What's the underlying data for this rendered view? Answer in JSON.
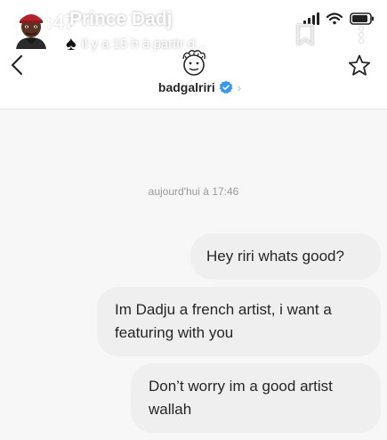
{
  "status_bar": {
    "time": ":47"
  },
  "story_overlay": {
    "name": "Prince Dadj",
    "subtitle": "il y a 15 h à partir d..."
  },
  "header": {
    "username": "badgalriri"
  },
  "conversation": {
    "timestamp": "aujourd'hui à 17:46",
    "messages": [
      {
        "text": "Hey riri whats good?"
      },
      {
        "text": "Im Dadju a french artist, i want a featuring with you"
      },
      {
        "text": "Don’t worry im a good artist wallah"
      }
    ]
  },
  "colors": {
    "bubble": "#efefef",
    "verified": "#3897f0",
    "background": "#f7f7f7"
  },
  "icons": [
    "spade-icon",
    "bookmark-icon",
    "more-icon",
    "back-icon",
    "verified-icon",
    "chevron-right-icon",
    "star-icon",
    "signal-icon",
    "wifi-icon",
    "battery-icon"
  ]
}
